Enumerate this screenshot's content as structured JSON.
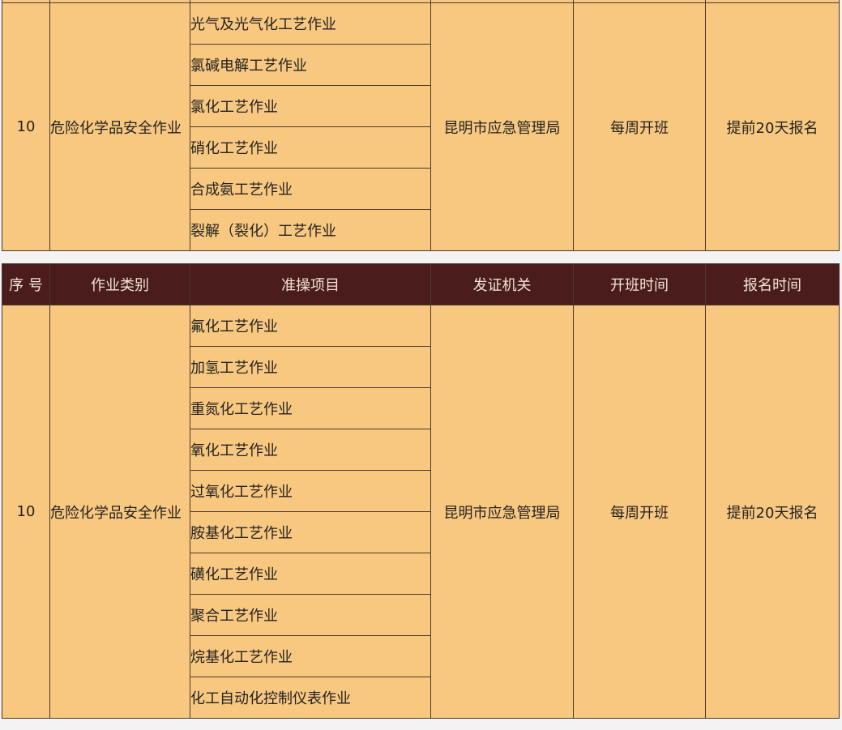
{
  "table_top": {
    "group": {
      "no": "10",
      "category": "危险化学品安全作业",
      "issuer": "昆明市应急管理局",
      "class_time": "每周开班",
      "register_time": "提前20天报名",
      "items": [
        "光气及光气化工艺作业",
        "氯碱电解工艺作业",
        "氯化工艺作业",
        "硝化工艺作业",
        "合成氨工艺作业",
        "裂解（裂化）工艺作业"
      ]
    }
  },
  "table_bottom": {
    "headers": {
      "no": "序 号",
      "category": "作业类别",
      "item": "准操项目",
      "issuer": "发证机关",
      "class_time": "开班时间",
      "register_time": "报名时间"
    },
    "group": {
      "no": "10",
      "category": "危险化学品安全作业",
      "issuer": "昆明市应急管理局",
      "class_time": "每周开班",
      "register_time": "提前20天报名",
      "items": [
        "氟化工艺作业",
        "加氢工艺作业",
        "重氮化工艺作业",
        "氧化工艺作业",
        "过氧化工艺作业",
        "胺基化工艺作业",
        "磺化工艺作业",
        "聚合工艺作业",
        "烷基化工艺作业",
        "化工自动化控制仪表作业"
      ]
    }
  },
  "colors": {
    "cell_bg": "#f9c880",
    "header_bg": "#4a1c1c",
    "header_text": "#f3e4d6",
    "border": "#4b3a2a",
    "page_bg": "#f3f3f3"
  }
}
